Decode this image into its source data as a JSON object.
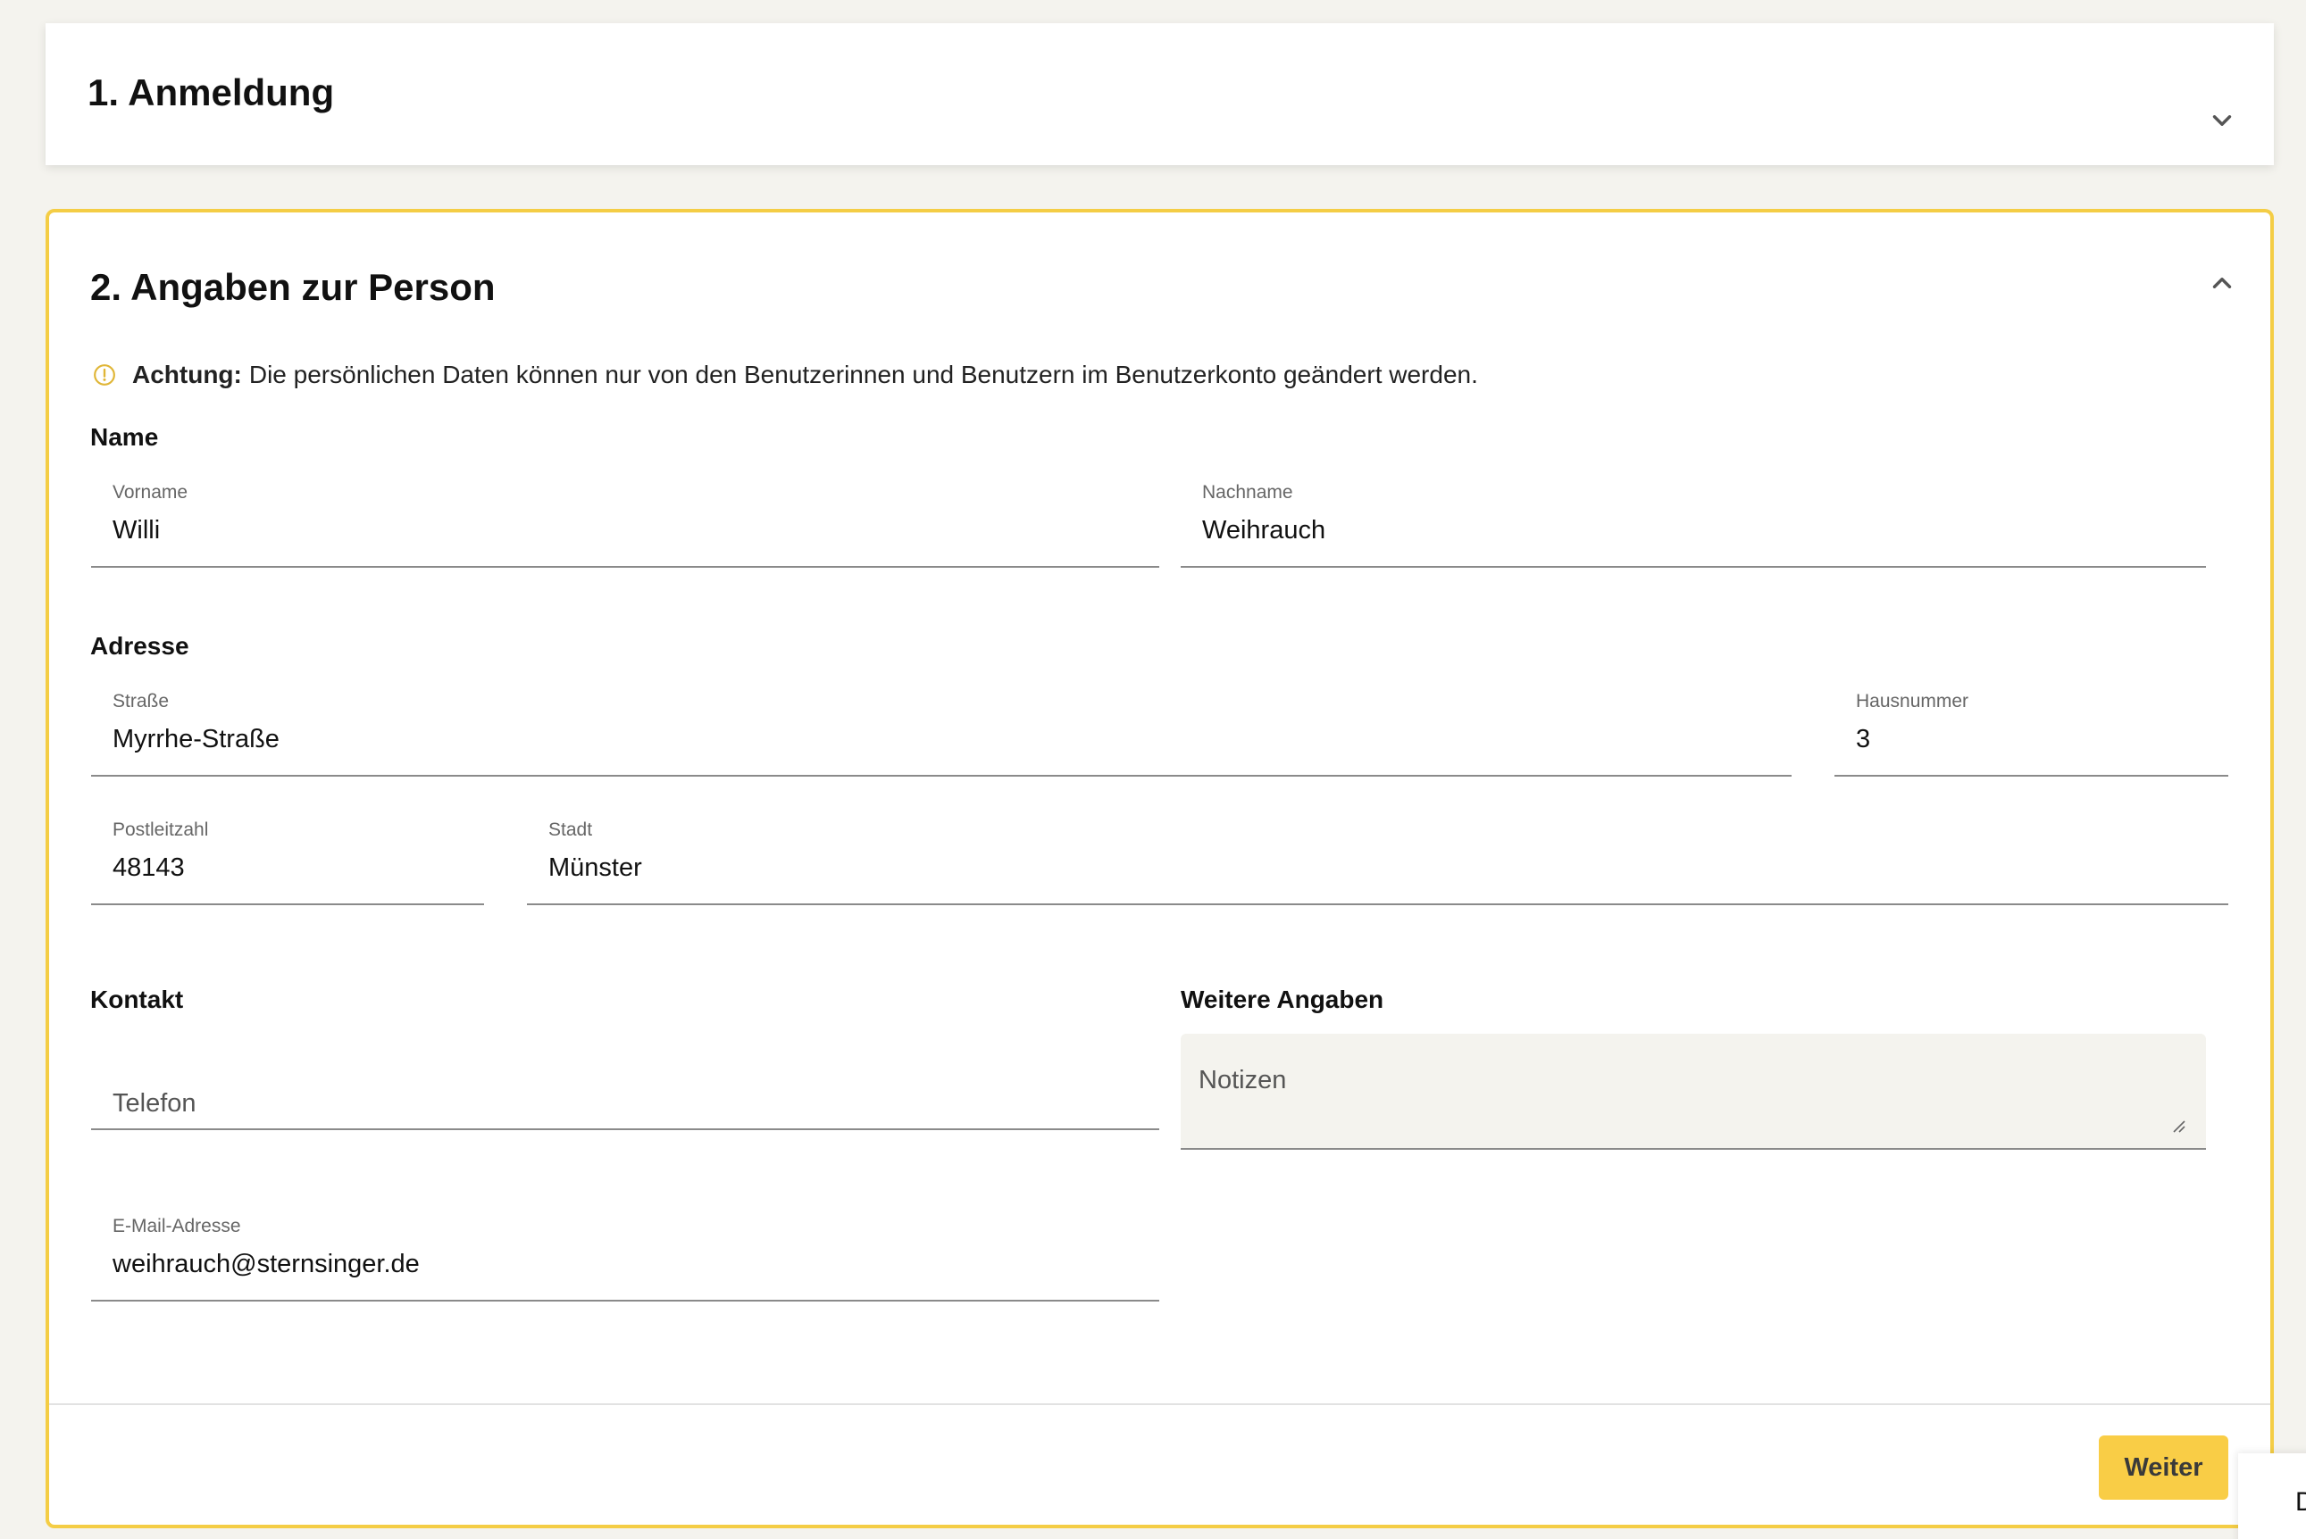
{
  "section1": {
    "title": "1. Anmeldung"
  },
  "section2": {
    "title": "2. Angaben zur Person",
    "notice_strong": "Achtung:",
    "notice_text": "Die persönlichen Daten können nur von den Benutzerinnen und Benutzern im Benutzerkonto geändert werden.",
    "groups": {
      "name": "Name",
      "address": "Adresse",
      "contact": "Kontakt",
      "more": "Weitere Angaben"
    },
    "fields": {
      "vorname": {
        "label": "Vorname",
        "value": "Willi"
      },
      "nachname": {
        "label": "Nachname",
        "value": "Weihrauch"
      },
      "strasse": {
        "label": "Straße",
        "value": "Myrrhe-Straße"
      },
      "hausnummer": {
        "label": "Hausnummer",
        "value": "3"
      },
      "plz": {
        "label": "Postleitzahl",
        "value": "48143"
      },
      "stadt": {
        "label": "Stadt",
        "value": "Münster"
      },
      "telefon": {
        "placeholder": "Telefon"
      },
      "notizen": {
        "placeholder": "Notizen"
      },
      "email": {
        "label": "E-Mail-Adresse",
        "value": "weihrauch@sternsinger.de"
      }
    },
    "next_label": "Weiter"
  },
  "corner": {
    "text": "D"
  },
  "colors": {
    "accent": "#f4cd45",
    "button": "#f9cd46",
    "background": "#f4f3ee"
  }
}
